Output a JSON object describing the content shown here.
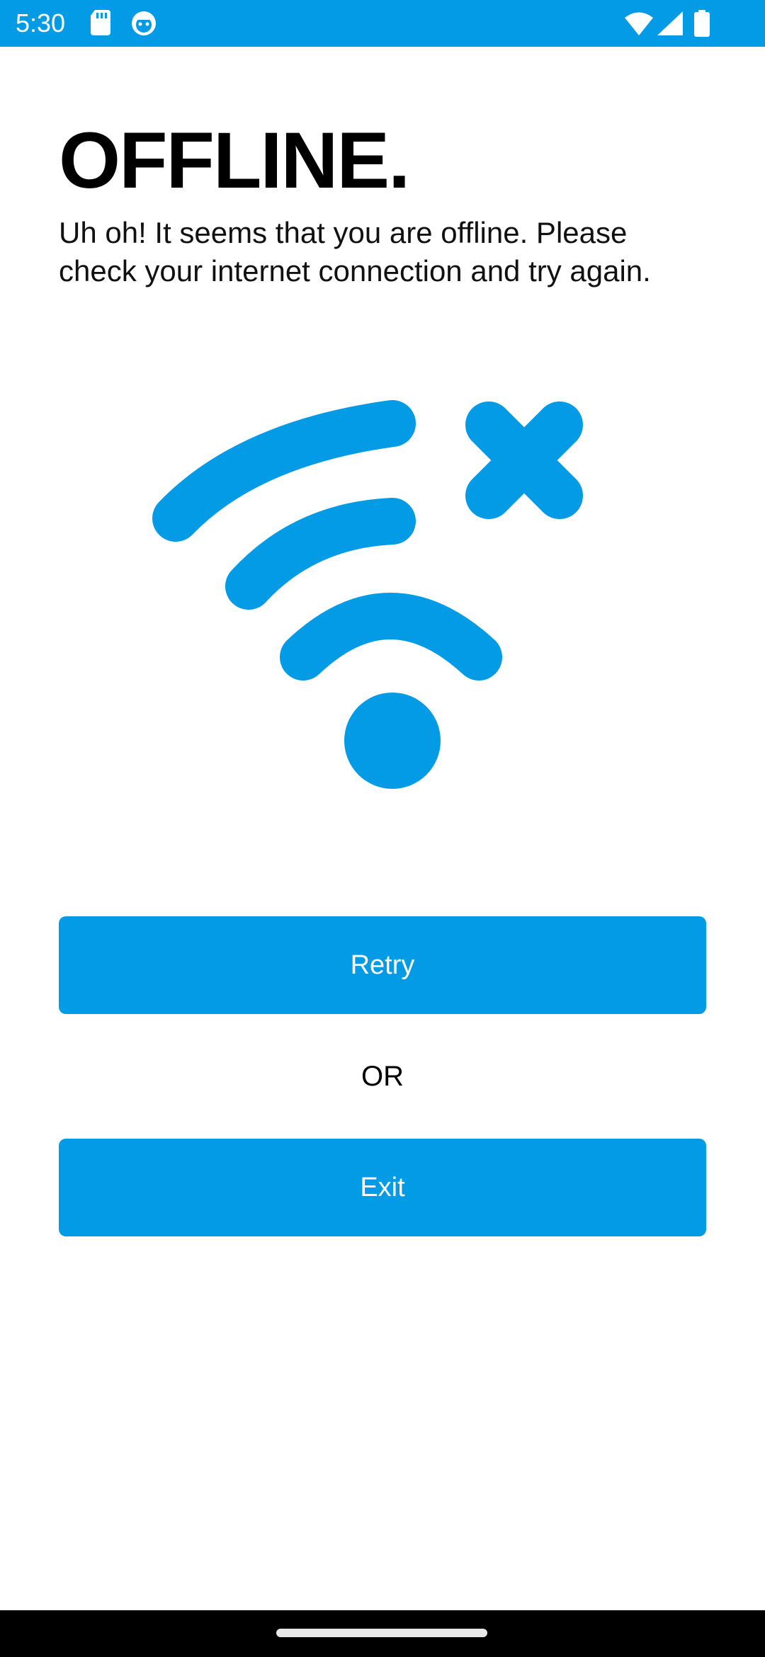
{
  "status_bar": {
    "time": "5:30",
    "background_color": "#039BE5",
    "left_icons": [
      "sd-card-icon",
      "android-face-icon"
    ],
    "right_icons": [
      "wifi-icon",
      "cell-signal-icon",
      "battery-icon"
    ]
  },
  "main": {
    "title": "OFFLINE.",
    "message": "Uh oh! It seems that you are offline. Please check your internet connection and try again.",
    "illustration": "wifi-off-icon",
    "accent_color": "#039BE5"
  },
  "actions": {
    "retry_label": "Retry",
    "separator": "OR",
    "exit_label": "Exit"
  },
  "nav_bar": {
    "handle": "home-indicator"
  }
}
